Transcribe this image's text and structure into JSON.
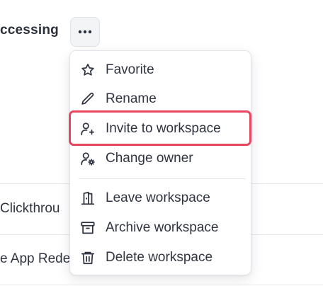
{
  "background": {
    "title": "ccessing",
    "rows": [
      {
        "text": "Clickthrou"
      },
      {
        "text": "e App Rede"
      }
    ]
  },
  "more_button": {
    "icon": "more-horizontal-icon"
  },
  "menu": {
    "items": [
      {
        "label": "Favorite",
        "icon": "star-icon"
      },
      {
        "label": "Rename",
        "icon": "pencil-icon"
      },
      {
        "label": "Invite to workspace",
        "icon": "user-plus-icon",
        "highlighted": true
      },
      {
        "label": "Change owner",
        "icon": "user-cog-icon"
      },
      {
        "label": "Leave workspace",
        "icon": "door-exit-icon"
      },
      {
        "label": "Archive workspace",
        "icon": "archive-icon"
      },
      {
        "label": "Delete workspace",
        "icon": "trash-icon"
      }
    ]
  },
  "colors": {
    "highlight": "#e8455e",
    "text": "#2f3440",
    "border": "#e3e5ea"
  }
}
